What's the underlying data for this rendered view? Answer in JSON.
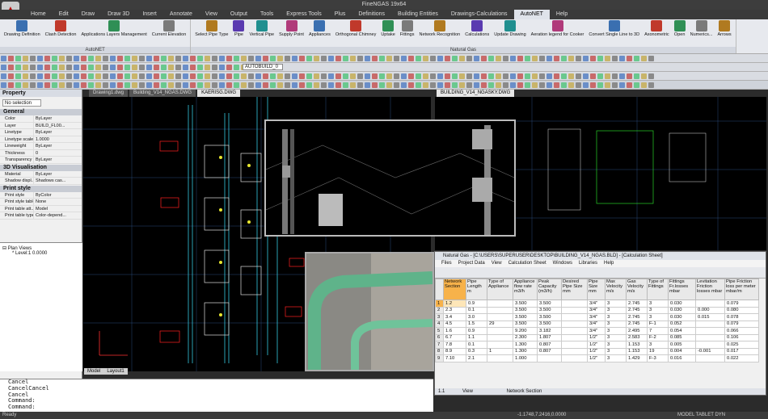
{
  "window": {
    "title": "FineNGAS 19x64"
  },
  "menu": [
    "Home",
    "Edit",
    "Draw",
    "Draw 3D",
    "Insert",
    "Annotate",
    "View",
    "Output",
    "Tools",
    "Express Tools",
    "Plus",
    "Definitions",
    "Building Entities",
    "Drawings-Calculations",
    "AutoNET",
    "Help"
  ],
  "menu_active": "AutoNET",
  "ribbon": {
    "groups": [
      {
        "label": "AutoNET",
        "buttons": [
          "Drawing Definition",
          "Clash Detection",
          "Applications Layers Management",
          "Current Elevation"
        ]
      },
      {
        "label": "Natural Gas",
        "buttons": [
          "Select Pipe Type",
          "Pipe",
          "Vertical Pipe",
          "Supply Point",
          "Appliances",
          "Orthogonal Chimney",
          "Uptake",
          "Fittings",
          "Network Recognition",
          "Calculations",
          "Update Drawing",
          "Aeration legend for Cooker",
          "Convert Single Line to 3D",
          "Axonometric",
          "Open",
          "Numerics...",
          "Arrows"
        ]
      }
    ]
  },
  "toolbar": {
    "layer_combo": "AUTOBUILD_0"
  },
  "property": {
    "title": "Property",
    "selection": "No selection",
    "sections": [
      {
        "name": "General",
        "rows": [
          [
            "Color",
            "ByLayer"
          ],
          [
            "Layer",
            "BUILD_FL00..."
          ],
          [
            "Linetype",
            "ByLayer"
          ],
          [
            "Linetype scale",
            "1.0000"
          ],
          [
            "Lineweight",
            "ByLayer"
          ],
          [
            "Thickness",
            "0"
          ],
          [
            "Transparency",
            "ByLayer"
          ]
        ]
      },
      {
        "name": "3D Visualisation",
        "rows": [
          [
            "Material",
            "ByLayer"
          ],
          [
            "Shadow displ...",
            "Shadows cas..."
          ]
        ]
      },
      {
        "name": "Print style",
        "rows": [
          [
            "Print style",
            "ByColor"
          ],
          [
            "Print style table",
            "None"
          ],
          [
            "Print table att...",
            "Model"
          ],
          [
            "Print table type",
            "Color-depend..."
          ]
        ]
      }
    ]
  },
  "tree": {
    "root": "Plan Views",
    "child": "Level:1  0.0000"
  },
  "doc_tabs": [
    "Drawing1.dwg",
    "Building_V14_NGAS.DWG",
    "KAERISG.DWG"
  ],
  "doc_tab_active": "KAERISG.DWG",
  "view2_tab": "BUILDING_V14_NGASKY.DWG",
  "model_tabs": [
    "Model",
    "Layout1"
  ],
  "calc": {
    "title": "Natural Gas - [C:\\USERS\\SUPERUSER\\DESKTOP\\BUILDING_V14_NGAS.BLD] - [Calculation Sheet]",
    "menu": [
      "Files",
      "Project Data",
      "View",
      "Calculation Sheet",
      "Windows",
      "Libraries",
      "Help"
    ],
    "headers": [
      "Network Section",
      "Pipe Length m",
      "Type of Appliance",
      "Appliance flow rate m3/h",
      "Peak Capacity (m3/h)",
      "Desired Pipe Size mm",
      "Pipe Size mm",
      "Max Velocity m/s",
      "Gas Velocity m/s",
      "Type of Fittings",
      "Fittings Fr.losses mbar",
      "Levitation Friction losses mbar",
      "Pipe Friction loss per meter mbar/m"
    ],
    "rows": [
      [
        "1",
        "1.2",
        "0.9",
        "",
        "3.500",
        "3.500",
        "",
        "3/4\"",
        "3",
        "2.745",
        "3",
        "0.030",
        "",
        "0.079"
      ],
      [
        "2",
        "2.3",
        "0.1",
        "",
        "3.500",
        "3.500",
        "",
        "3/4\"",
        "3",
        "2.745",
        "3",
        "0.030",
        "0.000",
        "0.080"
      ],
      [
        "3",
        "3.4",
        "3.0",
        "",
        "3.500",
        "3.500",
        "",
        "3/4\"",
        "3",
        "2.745",
        "3",
        "0.030",
        "0.015",
        "0.078"
      ],
      [
        "4",
        "4.5",
        "1.5",
        "29",
        "3.500",
        "3.500",
        "",
        "3/4\"",
        "3",
        "2.745",
        "F-1",
        "0.052",
        "",
        "0.079"
      ],
      [
        "5",
        "1.6",
        "0.9",
        "",
        "9.200",
        "3.182",
        "",
        "3/4\"",
        "3",
        "2.495",
        "7",
        "0.054",
        "",
        "0.066"
      ],
      [
        "6",
        "6.7",
        "1.1",
        "",
        "2.300",
        "1.807",
        "",
        "1/2\"",
        "3",
        "2.583",
        "F-2",
        "0.085",
        "",
        "0.106"
      ],
      [
        "7",
        "7.8",
        "0.1",
        "",
        "1.300",
        "0.807",
        "",
        "1/2\"",
        "3",
        "1.153",
        "3",
        "0.005",
        "",
        "0.025"
      ],
      [
        "8",
        "8.9",
        "0.3",
        "1",
        "1.300",
        "0.807",
        "",
        "1/2\"",
        "3",
        "1.153",
        "19",
        "0.004",
        "-0.001",
        "0.017"
      ],
      [
        "9",
        "7.10",
        "2.1",
        "",
        "1.000",
        "",
        "",
        "1/2\"",
        "3",
        "1.429",
        "F-3",
        "0.016",
        "",
        "0.022"
      ]
    ],
    "status_left": "1.1",
    "status_mid": "View",
    "status_right": "Network Section"
  },
  "command": {
    "lines": [
      "Cancel",
      "CancelCancel",
      "Cancel",
      "Command:",
      "Command:"
    ]
  },
  "statusbar": {
    "left": "Ready",
    "coords": "-1.1748,7.2416,0.0000",
    "right": "MODEL TABLET DYN"
  }
}
